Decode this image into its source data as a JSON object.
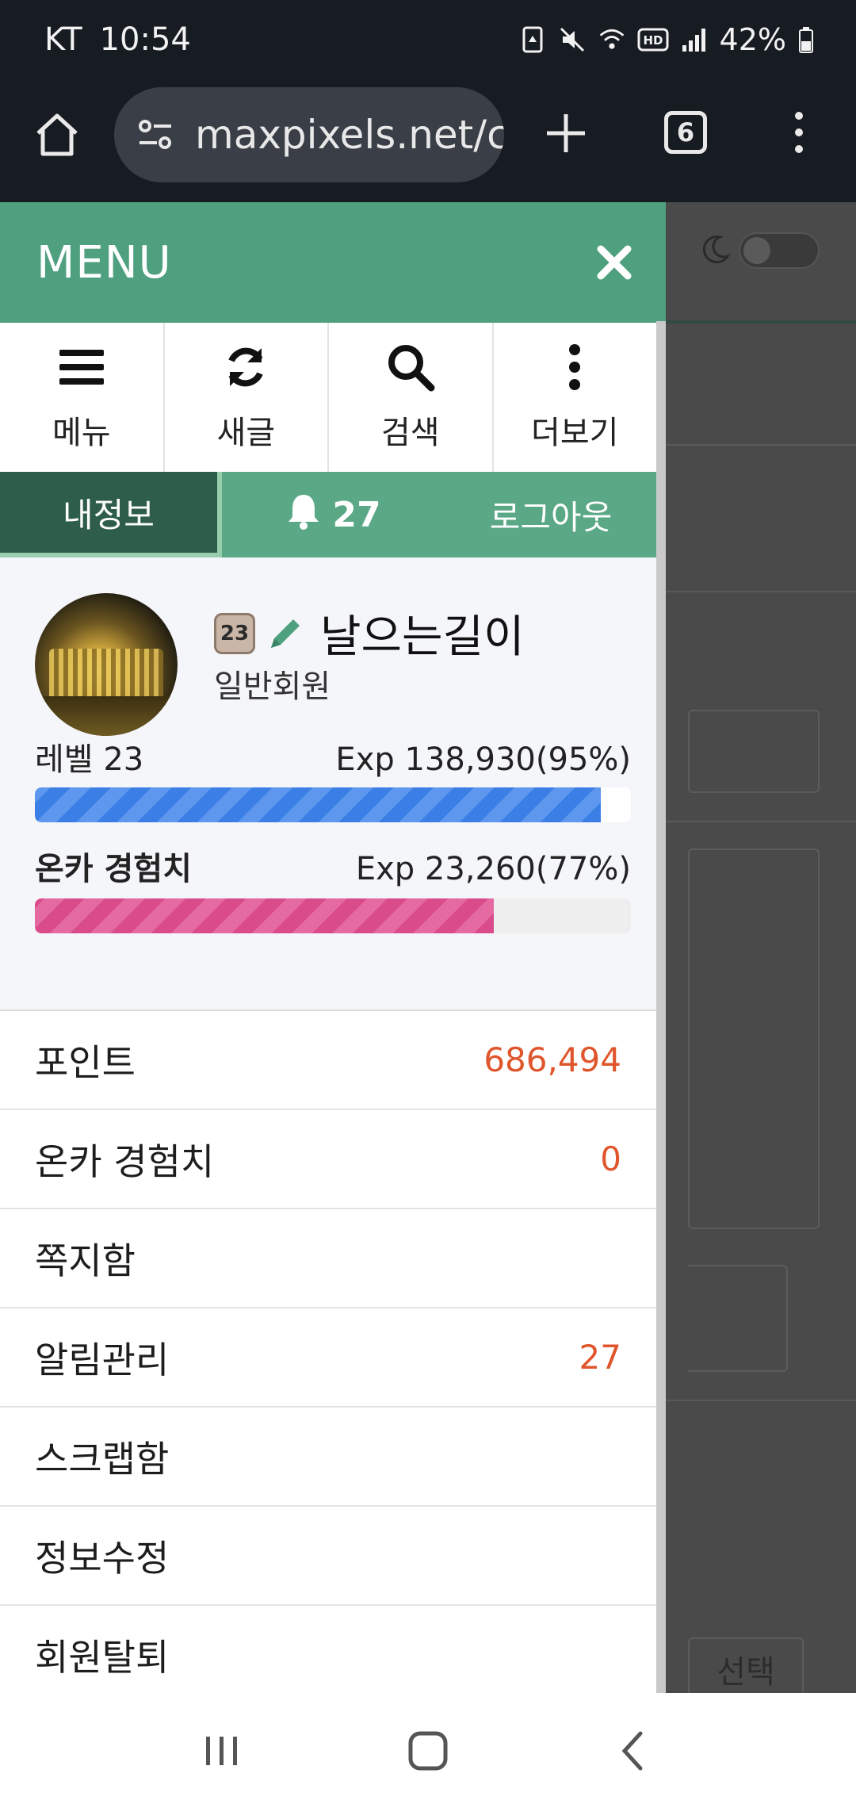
{
  "status_bar": {
    "carrier": "KT",
    "time": "10:54",
    "battery_percent": "42%",
    "icons": [
      "recycle-icon",
      "mute-icon",
      "wifi-icon",
      "hd-icon",
      "signal-icon",
      "battery-icon"
    ]
  },
  "browser": {
    "url": "maxpixels.net/c",
    "tab_count": "6",
    "icons": [
      "home-icon",
      "site-settings-icon",
      "new-tab-icon",
      "tabs-icon",
      "more-icon"
    ]
  },
  "drawer": {
    "title": "MENU",
    "tools": [
      {
        "label": "메뉴",
        "icon": "hamburger-icon"
      },
      {
        "label": "새글",
        "icon": "refresh-icon"
      },
      {
        "label": "검색",
        "icon": "search-icon"
      },
      {
        "label": "더보기",
        "icon": "more-vertical-icon"
      }
    ],
    "tabs": {
      "my_info": "내정보",
      "notification_count": "27",
      "logout": "로그아웃"
    },
    "profile": {
      "level_badge": "23",
      "name": "날으는길이",
      "grade": "일반회원",
      "level_label": "레벨 23",
      "exp_text": "Exp 138,930(95%)",
      "exp_progress": 0.95,
      "onca_label": "온카 경험치",
      "onca_exp_text": "Exp 23,260(77%)",
      "onca_progress": 0.77
    },
    "list": [
      {
        "label": "포인트",
        "value": "686,494"
      },
      {
        "label": "온카 경험치",
        "value": "0"
      },
      {
        "label": "쪽지함",
        "value": ""
      },
      {
        "label": "알림관리",
        "value": "27"
      },
      {
        "label": "스크랩함",
        "value": ""
      },
      {
        "label": "정보수정",
        "value": ""
      },
      {
        "label": "회원탈퇴",
        "value": ""
      }
    ]
  },
  "background_page": {
    "select_label": "선택"
  },
  "colors": {
    "menu_green": "#4fa07f",
    "tab_dark_green": "#2e5e4a",
    "value_orange": "#e0562c",
    "exp_blue": "#3b7fe6",
    "exp_pink": "#da4b8b"
  }
}
